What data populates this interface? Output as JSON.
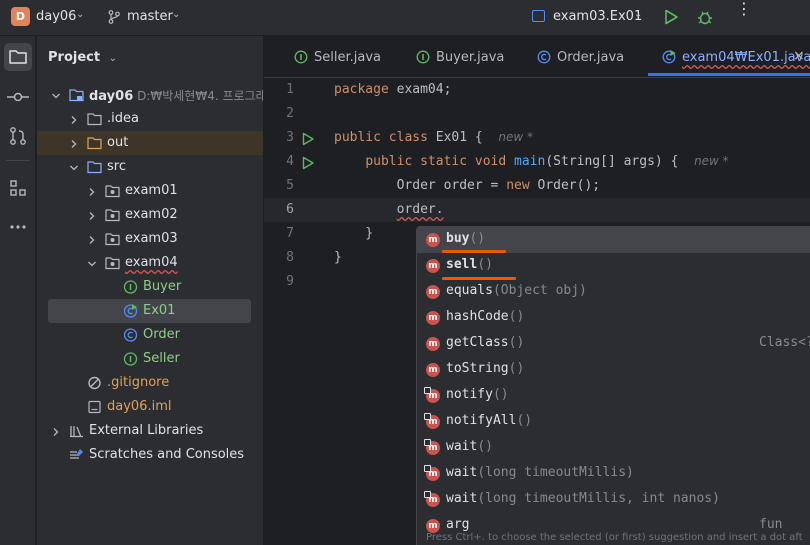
{
  "titlebar": {
    "project_initial": "D",
    "project_name": "day06",
    "branch": "master",
    "run_config": "exam03.Ex01"
  },
  "project_panel": {
    "header": "Project",
    "tree": [
      {
        "label": "day06",
        "hint": "D:₩박세현₩4. 프로그래",
        "icon": "module-folder-icon",
        "arrow": "expanded",
        "depth": 0
      },
      {
        "label": ".idea",
        "icon": "folder-icon",
        "arrow": "collapsed",
        "depth": 1
      },
      {
        "label": "out",
        "icon": "folder-orange-icon",
        "arrow": "collapsed",
        "depth": 1,
        "excluded": true
      },
      {
        "label": "src",
        "icon": "source-folder-icon",
        "arrow": "expanded",
        "depth": 1
      },
      {
        "label": "exam01",
        "icon": "package-icon",
        "arrow": "collapsed",
        "depth": 2
      },
      {
        "label": "exam02",
        "icon": "package-icon",
        "arrow": "collapsed",
        "depth": 2
      },
      {
        "label": "exam03",
        "icon": "package-icon",
        "arrow": "collapsed",
        "depth": 2
      },
      {
        "label": "exam04",
        "icon": "package-icon",
        "arrow": "expanded",
        "depth": 2,
        "squiggle": true
      },
      {
        "label": "Buyer",
        "icon": "interface-icon",
        "depth": 3,
        "color": "#8dcf86"
      },
      {
        "label": "Ex01",
        "icon": "class-run-icon",
        "depth": 3,
        "color": "#8dcf86",
        "selected": true
      },
      {
        "label": "Order",
        "icon": "class-icon",
        "depth": 3,
        "color": "#8dcf86"
      },
      {
        "label": "Seller",
        "icon": "interface-icon",
        "depth": 3,
        "color": "#8dcf86"
      },
      {
        "label": ".gitignore",
        "icon": "ignore-file-icon",
        "depth": 1,
        "color": "#e0a15c"
      },
      {
        "label": "day06.iml",
        "icon": "iml-file-icon",
        "depth": 1,
        "color": "#e0a15c"
      },
      {
        "label": "External Libraries",
        "icon": "libraries-icon",
        "arrow": "collapsed",
        "depth": 0
      },
      {
        "label": "Scratches and Consoles",
        "icon": "scratches-icon",
        "depth": 0
      }
    ]
  },
  "tabs": [
    {
      "label": "Seller.java",
      "icon": "interface-icon"
    },
    {
      "label": "Buyer.java",
      "icon": "interface-icon"
    },
    {
      "label": "Order.java",
      "icon": "class-icon"
    },
    {
      "label": "exam04₩Ex01.java",
      "icon": "class-run-icon",
      "active": true
    }
  ],
  "code": {
    "line_numbers": [
      "1",
      "2",
      "3",
      "4",
      "5",
      "6",
      "7",
      "8",
      "9"
    ],
    "new_hint": "new *"
  },
  "completion": {
    "items": [
      {
        "name": "buy",
        "args": "()",
        "type": "",
        "bold": true,
        "selected": true
      },
      {
        "name": "sell",
        "args": "()",
        "type": "",
        "bold": true
      },
      {
        "name": "equals",
        "args": "(Object obj)",
        "type": ""
      },
      {
        "name": "hashCode",
        "args": "()",
        "type": ""
      },
      {
        "name": "getClass",
        "args": "()",
        "type": "Class<?"
      },
      {
        "name": "toString",
        "args": "()",
        "type": ""
      },
      {
        "name": "notify",
        "args": "()",
        "type": "",
        "locked": true
      },
      {
        "name": "notifyAll",
        "args": "()",
        "type": "",
        "locked": true
      },
      {
        "name": "wait",
        "args": "()",
        "type": "",
        "locked": true
      },
      {
        "name": "wait",
        "args": "(long timeoutMillis)",
        "type": "",
        "locked": true
      },
      {
        "name": "wait",
        "args": "(long timeoutMillis, int nanos)",
        "type": "",
        "locked": true
      },
      {
        "name": "arg",
        "args": "",
        "type": "fun"
      }
    ],
    "footer": "Press Ctrl+. to choose the selected (or first) suggestion and insert a dot aft"
  },
  "colors": {
    "accent": "#3574f0",
    "method_icon": "#c75450",
    "run_green": "#5fb865",
    "highlight_mark": "#e8590c"
  }
}
